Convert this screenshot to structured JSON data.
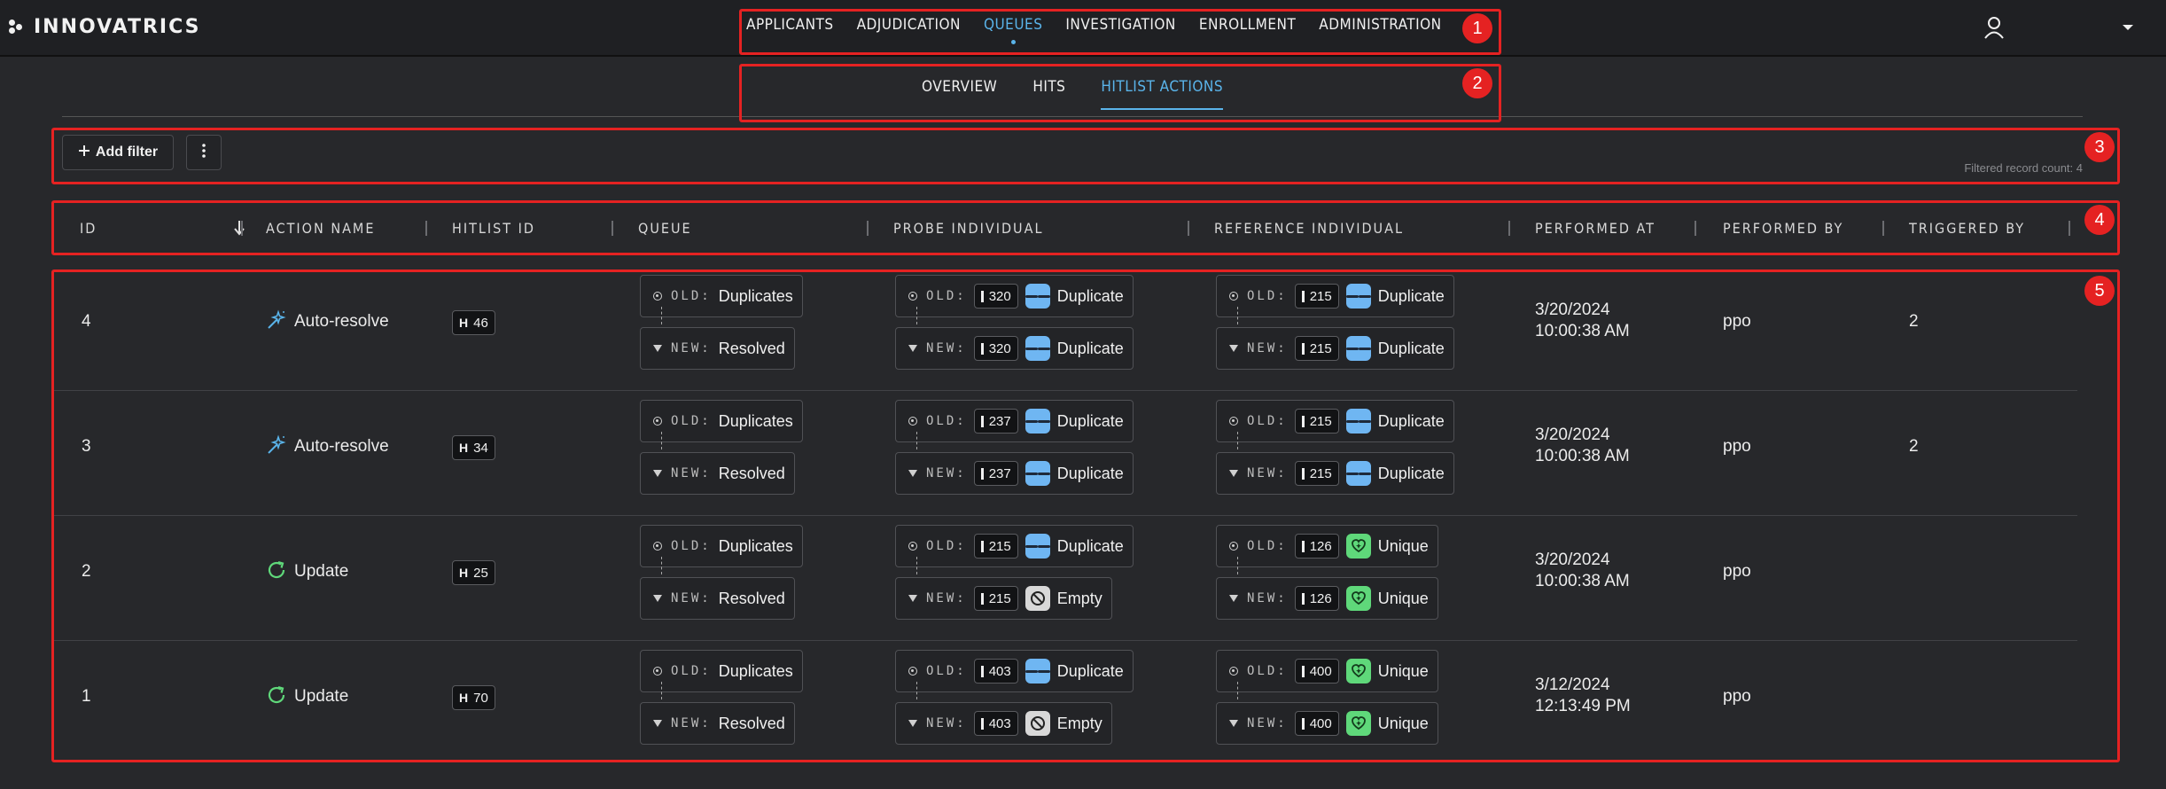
{
  "app": {
    "logo_text": "INNOVATRICS"
  },
  "main_nav": [
    {
      "label": "APPLICANTS",
      "active": false
    },
    {
      "label": "ADJUDICATION",
      "active": false
    },
    {
      "label": "QUEUES",
      "active": true
    },
    {
      "label": "INVESTIGATION",
      "active": false
    },
    {
      "label": "ENROLLMENT",
      "active": false
    },
    {
      "label": "ADMINISTRATION",
      "active": false
    }
  ],
  "sub_nav": [
    {
      "label": "OVERVIEW",
      "active": false
    },
    {
      "label": "HITS",
      "active": false
    },
    {
      "label": "HITLIST ACTIONS",
      "active": true
    }
  ],
  "toolbar": {
    "add_filter_label": "Add filter",
    "record_count": "Filtered record count: 4"
  },
  "table": {
    "columns": [
      "ID",
      "ACTION NAME",
      "HITLIST ID",
      "QUEUE",
      "PROBE INDIVIDUAL",
      "REFERENCE INDIVIDUAL",
      "PERFORMED AT",
      "PERFORMED BY",
      "TRIGGERED BY"
    ],
    "old_prefix": "OLD:",
    "new_prefix": "NEW:",
    "rows": [
      {
        "id": "4",
        "action": "Auto-resolve",
        "action_icon": "magic-wand-icon",
        "hitlist_prefix": "H",
        "hitlist_id": "46",
        "queue_old": "Duplicates",
        "queue_new": "Resolved",
        "probe_old_id": "320",
        "probe_old_status": "Duplicate",
        "probe_new_id": "320",
        "probe_new_status": "Duplicate",
        "ref_old_id": "215",
        "ref_old_status": "Duplicate",
        "ref_new_id": "215",
        "ref_new_status": "Duplicate",
        "performed_date": "3/20/2024",
        "performed_time": "10:00:38 AM",
        "performed_by": "ppo",
        "triggered_by": "2"
      },
      {
        "id": "3",
        "action": "Auto-resolve",
        "action_icon": "magic-wand-icon",
        "hitlist_prefix": "H",
        "hitlist_id": "34",
        "queue_old": "Duplicates",
        "queue_new": "Resolved",
        "probe_old_id": "237",
        "probe_old_status": "Duplicate",
        "probe_new_id": "237",
        "probe_new_status": "Duplicate",
        "ref_old_id": "215",
        "ref_old_status": "Duplicate",
        "ref_new_id": "215",
        "ref_new_status": "Duplicate",
        "performed_date": "3/20/2024",
        "performed_time": "10:00:38 AM",
        "performed_by": "ppo",
        "triggered_by": "2"
      },
      {
        "id": "2",
        "action": "Update",
        "action_icon": "refresh-icon",
        "hitlist_prefix": "H",
        "hitlist_id": "25",
        "queue_old": "Duplicates",
        "queue_new": "Resolved",
        "probe_old_id": "215",
        "probe_old_status": "Duplicate",
        "probe_new_id": "215",
        "probe_new_status": "Empty",
        "ref_old_id": "126",
        "ref_old_status": "Unique",
        "ref_new_id": "126",
        "ref_new_status": "Unique",
        "performed_date": "3/20/2024",
        "performed_time": "10:00:38 AM",
        "performed_by": "ppo",
        "triggered_by": ""
      },
      {
        "id": "1",
        "action": "Update",
        "action_icon": "refresh-icon",
        "hitlist_prefix": "H",
        "hitlist_id": "70",
        "queue_old": "Duplicates",
        "queue_new": "Resolved",
        "probe_old_id": "403",
        "probe_old_status": "Duplicate",
        "probe_new_id": "403",
        "probe_new_status": "Empty",
        "ref_old_id": "400",
        "ref_old_status": "Unique",
        "ref_new_id": "400",
        "ref_new_status": "Unique",
        "performed_date": "3/12/2024",
        "performed_time": "12:13:49 PM",
        "performed_by": "ppo",
        "triggered_by": ""
      }
    ]
  },
  "annotations": [
    "1",
    "2",
    "3",
    "4",
    "5"
  ],
  "colors": {
    "accent": "#5ab4ea",
    "annotation": "#e52222",
    "duplicate": "#6fb6f2",
    "unique": "#5fd87a",
    "empty": "#d8d8d8"
  }
}
